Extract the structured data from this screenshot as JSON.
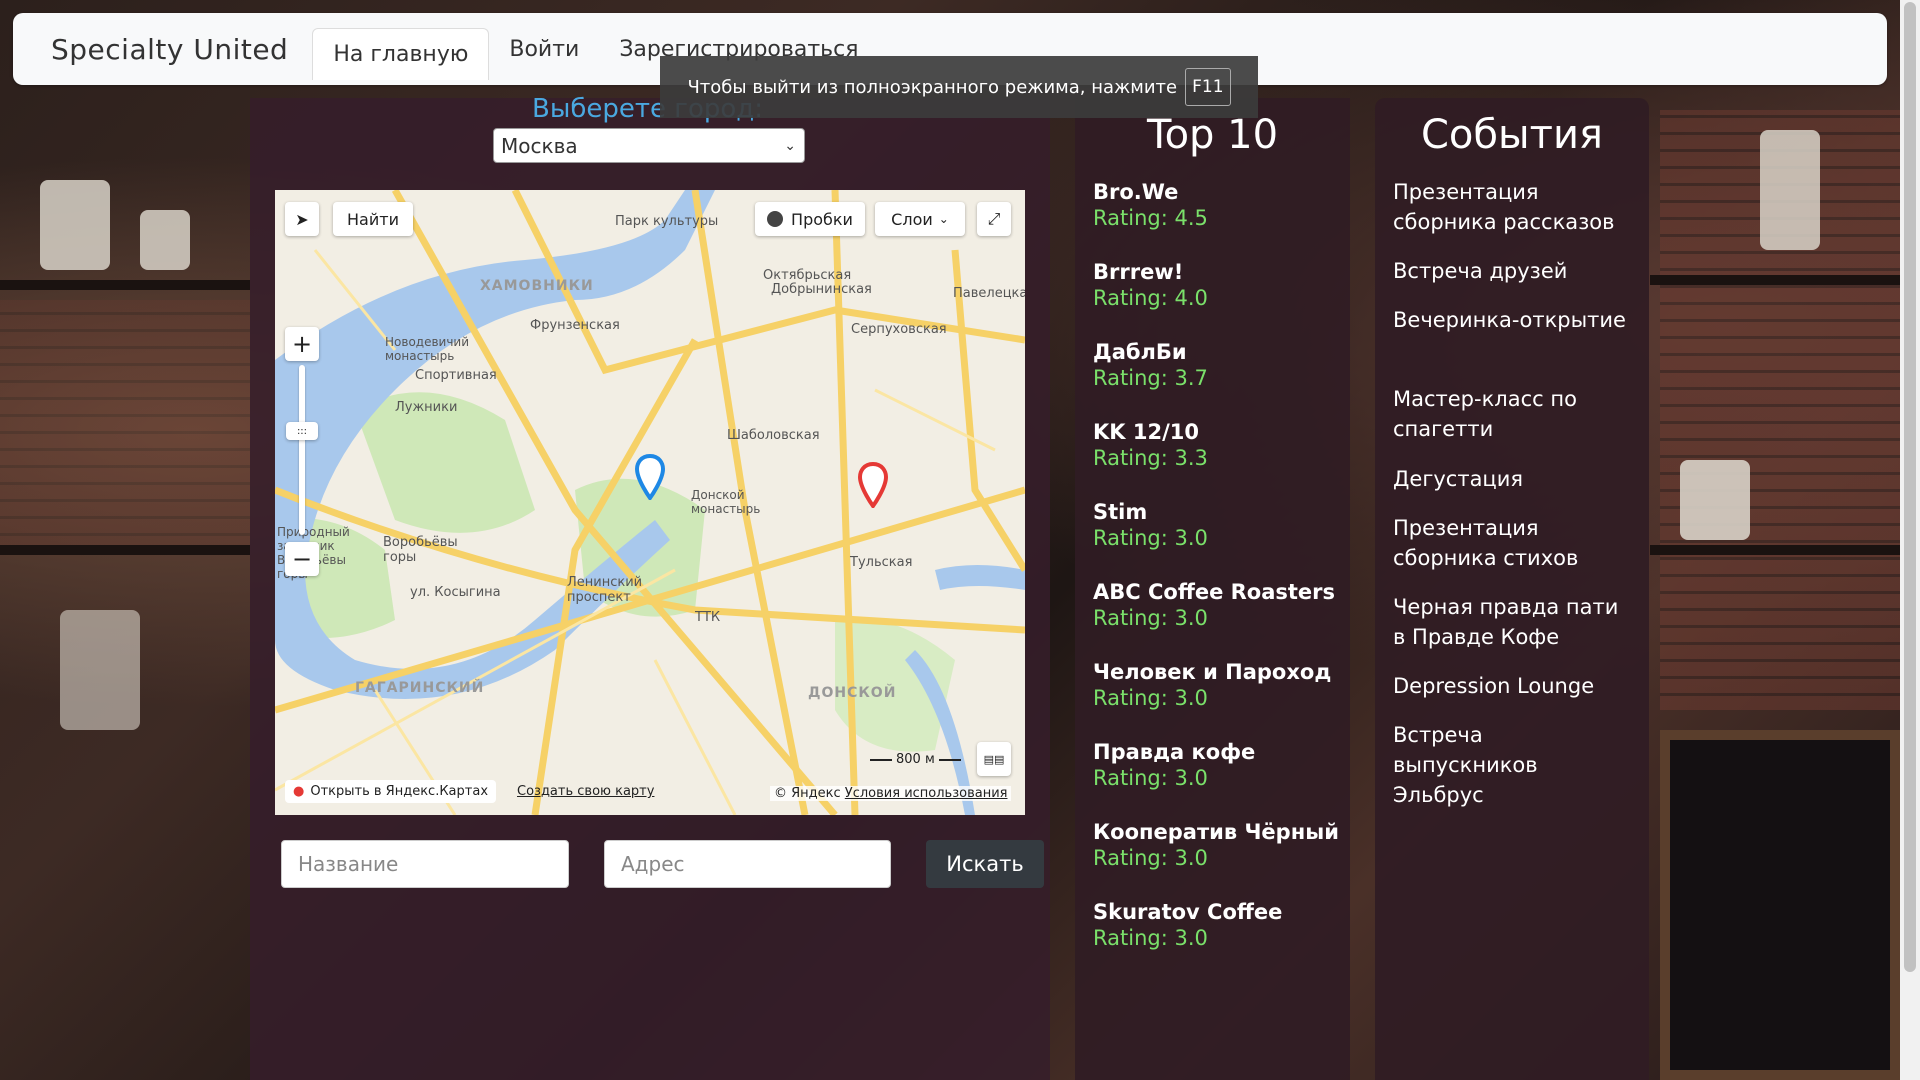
{
  "navbar": {
    "brand": "Specialty United",
    "links": [
      "На главную",
      "Войти",
      "Зарегистрироваться"
    ]
  },
  "fullscreen_notice": {
    "text": "Чтобы выйти из полноэкранного режима, нажмите",
    "key": "F11"
  },
  "city": {
    "label": "Выберете город:",
    "selected": "Москва"
  },
  "map": {
    "controls": {
      "find": "Найти",
      "traffic": "Пробки",
      "layers": "Слои",
      "zoom_in": "+",
      "zoom_out": "−"
    },
    "labels": [
      "Парк культуры",
      "ХАМОВНИКИ",
      "Фрунзенская",
      "Новодевичий монастырь",
      "Спортивная",
      "Лужники",
      "Октябрьская",
      "Добрынинская",
      "Павелецкая",
      "Серпуховская",
      "Шаболовская",
      "Донской монастырь",
      "Воробьёвы горы",
      "Ленинский проспект",
      "Тульская",
      "ГАГАРИНСКИЙ",
      "ДОНСКОЙ",
      "ул. Косыгина",
      "ТТК",
      "Природный заказник Воробьёвы горы"
    ],
    "scale": "800 м",
    "open_in": "Открыть в Яндекс.Картах",
    "create_map": "Создать свою карту",
    "copyright": "© Яндекс",
    "terms": "Условия использования"
  },
  "search": {
    "name_placeholder": "Название",
    "address_placeholder": "Адрес",
    "button": "Искать"
  },
  "top10": {
    "title": "Top 10",
    "items": [
      {
        "name": "Bro.We",
        "rating": "Rating: 4.5"
      },
      {
        "name": "Brrrew!",
        "rating": "Rating: 4.0"
      },
      {
        "name": "ДаблБи",
        "rating": "Rating: 3.7"
      },
      {
        "name": "KK 12/10",
        "rating": "Rating: 3.3"
      },
      {
        "name": "Stim",
        "rating": "Rating: 3.0"
      },
      {
        "name": "ABC Coffee Roasters",
        "rating": "Rating: 3.0"
      },
      {
        "name": "Человек и Пароход",
        "rating": "Rating: 3.0"
      },
      {
        "name": "Правда кофе",
        "rating": "Rating: 3.0"
      },
      {
        "name": "Кооператив Чёрный",
        "rating": "Rating: 3.0"
      },
      {
        "name": "Skuratov Coffee",
        "rating": "Rating: 3.0"
      }
    ]
  },
  "events": {
    "title": "События",
    "items": [
      "Презентация сборника рассказов",
      "Встреча друзей",
      "Вечеринка-открытие",
      "Мастер-класс по спагетти",
      "Дегустация",
      "Презентация сборника стихов",
      "Черная правда пати в Правде Кофе",
      "Depression Lounge",
      "Встреча выпускников Эльбрус"
    ]
  },
  "colors": {
    "accent": "#4aa8e0",
    "rating": "#7ae06a",
    "panel": "#361e2a",
    "button": "#343a40"
  }
}
